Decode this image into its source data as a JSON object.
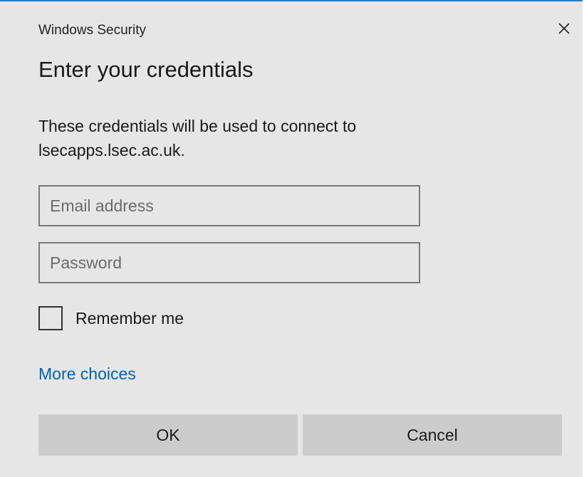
{
  "dialog": {
    "window_title": "Windows Security",
    "heading": "Enter your credentials",
    "description_line1": "These credentials will be used to connect to",
    "description_line2": "lsecapps.lsec.ac.uk."
  },
  "fields": {
    "email_placeholder": "Email address",
    "email_value": "",
    "password_placeholder": "Password",
    "password_value": ""
  },
  "remember": {
    "label": "Remember me",
    "checked": false
  },
  "links": {
    "more_choices": "More choices"
  },
  "buttons": {
    "ok": "OK",
    "cancel": "Cancel"
  },
  "icons": {
    "close": "close-icon"
  },
  "colors": {
    "accent_border": "#2b7bbf",
    "link": "#0063b1",
    "dialog_background": "#e6e6e6",
    "button_background": "#cccccc"
  }
}
